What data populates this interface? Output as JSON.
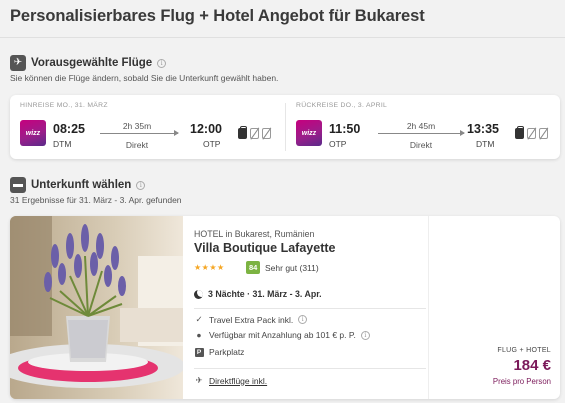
{
  "page": {
    "title": "Personalisierbares Flug + Hotel Angebot für Bukarest"
  },
  "flights_section": {
    "title": "Vorausgewählte Flüge",
    "subtitle": "Sie können die Flüge ändern, sobald Sie die Unterkunft gewählt haben.",
    "icon": "plane-icon",
    "outbound": {
      "heading": "HINREISE MO., 31. MÄRZ",
      "airline_logo_text": "wizz",
      "dep_time": "08:25",
      "dep_code": "DTM",
      "duration": "2h 35m",
      "stops": "Direkt",
      "arr_time": "12:00",
      "arr_code": "OTP"
    },
    "return": {
      "heading": "RÜCKREISE DO., 3. APRIL",
      "airline_logo_text": "wizz",
      "dep_time": "11:50",
      "dep_code": "OTP",
      "duration": "2h 45m",
      "stops": "Direkt",
      "arr_time": "13:35",
      "arr_code": "DTM"
    }
  },
  "accommodation_section": {
    "title": "Unterkunft wählen",
    "subtitle": "31 Ergebnisse für 31. März - 3. Apr. gefunden",
    "icon": "bed-icon"
  },
  "hotel": {
    "location": "HOTEL in Bukarest, Rumänien",
    "name": "Villa Boutique Lafayette",
    "stars": "★★★★",
    "star_count": 4,
    "score": "84",
    "rating_text": "Sehr gut (311)",
    "nights": "3 Nächte · 31. März - 3. Apr.",
    "features": [
      "Travel Extra Pack inkl.",
      "Verfügbar mit Anzahlung ab 101 € p. P.",
      "Parkplatz"
    ],
    "direct_flights": "Direktflüge inkl.",
    "price_label": "FLUG + HOTEL",
    "price": "184 €",
    "price_sub": "Preis pro Person"
  },
  "colors": {
    "accent": "#7b1a5a",
    "score_green": "#7cb342",
    "star": "#f5a623",
    "wizz_pink": "#c6007e"
  }
}
